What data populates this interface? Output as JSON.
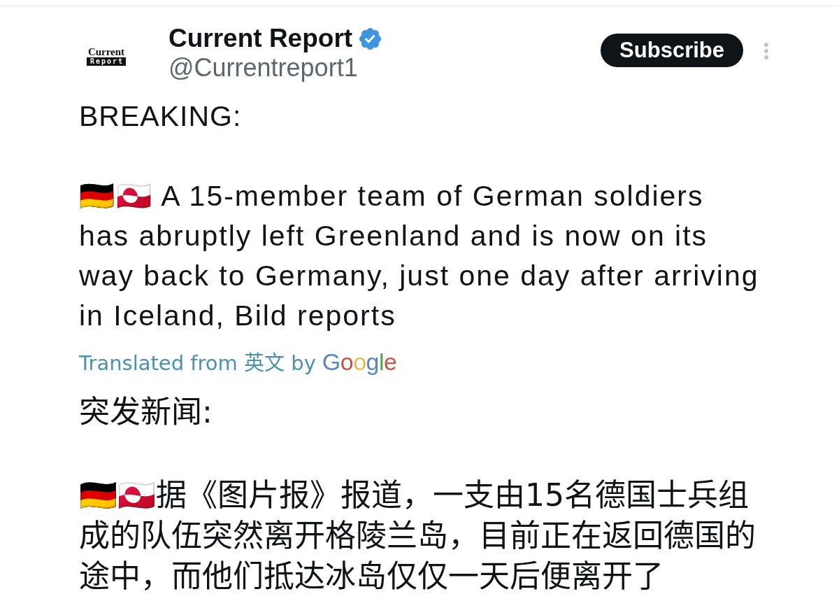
{
  "author": {
    "logo": {
      "top": "Current",
      "bottom": "Report"
    },
    "name": "Current Report",
    "verified": true,
    "handle": "@Currentreport1"
  },
  "subscribe_button": "Subscribe",
  "post": {
    "original": {
      "heading": "BREAKING:",
      "body": "🇩🇪🇬🇱 A 15-member team of German soldiers has abruptly left Greenland and is now on its way back to Germany, just one day after arriving in Iceland, Bild reports"
    },
    "translation_note": "Translated from 英文 by",
    "translator": "Google",
    "translated": {
      "heading": "突发新闻:",
      "body": "🇩🇪🇬🇱据《图片报》报道，一支由15名德国士兵组成的队伍突然离开格陵兰岛，目前正在返回德国的途中，而他们抵达冰岛仅仅一天后便离开了"
    }
  }
}
